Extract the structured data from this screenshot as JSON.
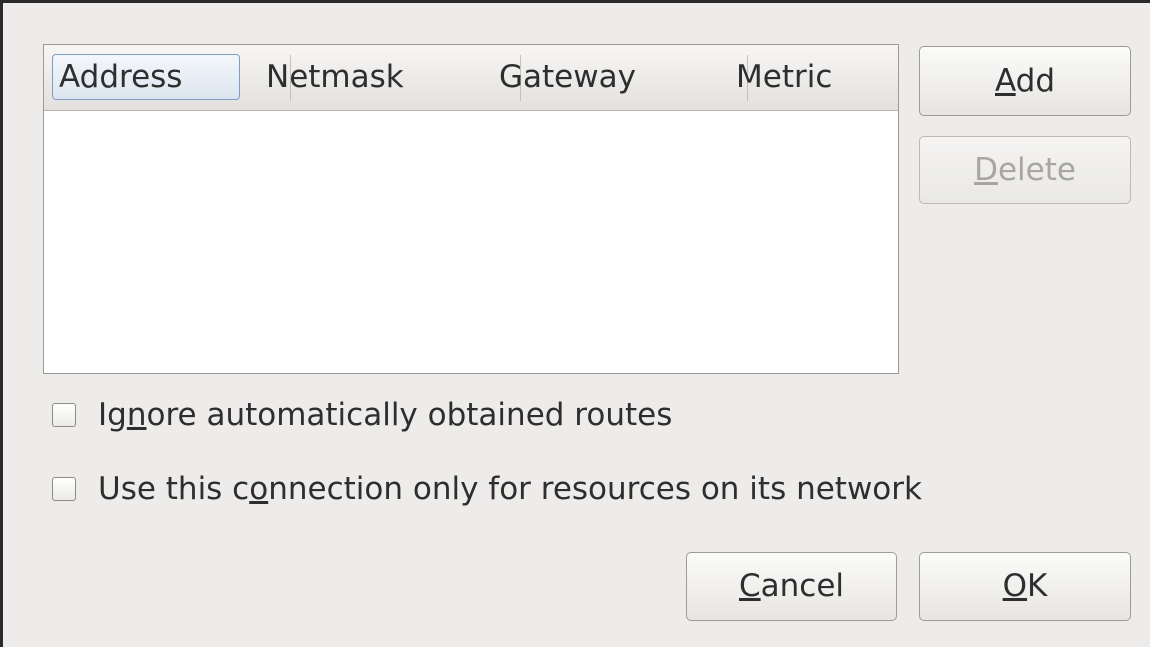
{
  "routes_table": {
    "columns": [
      "Address",
      "Netmask",
      "Gateway",
      "Metric"
    ],
    "rows": []
  },
  "buttons": {
    "add": {
      "pre": "",
      "mnemonic": "A",
      "post": "dd"
    },
    "delete": {
      "pre": "",
      "mnemonic": "D",
      "post": "elete"
    },
    "cancel": {
      "pre": "",
      "mnemonic": "C",
      "post": "ancel"
    },
    "ok": {
      "pre": "",
      "mnemonic": "O",
      "post": "K"
    }
  },
  "options": {
    "ignore_auto_routes": {
      "pre": "Ig",
      "mnemonic": "n",
      "post": "ore automatically obtained routes",
      "checked": false
    },
    "only_local_resources": {
      "pre": "Use this c",
      "mnemonic": "o",
      "post": "nnection only for resources on its network",
      "checked": false
    }
  }
}
